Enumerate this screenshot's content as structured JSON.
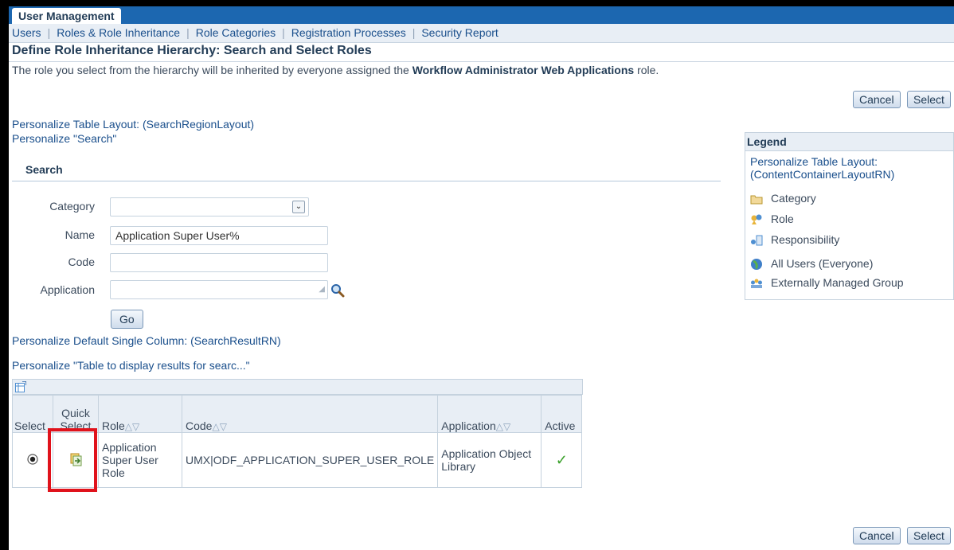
{
  "app_tab": "User Management",
  "nav": [
    "Users",
    "Roles & Role Inheritance",
    "Role Categories",
    "Registration Processes",
    "Security Report"
  ],
  "title": "Define Role Inheritance Hierarchy: Search and Select Roles",
  "instruction": {
    "pre": "The role you select from the hierarchy will be inherited by everyone assigned the ",
    "bold": "Workflow Administrator Web Applications",
    "post": " role."
  },
  "buttons": {
    "cancel": "Cancel",
    "select": "Select",
    "go": "Go"
  },
  "links": {
    "personalize_search_region": "Personalize Table Layout: (SearchRegionLayout)",
    "personalize_search": "Personalize \"Search\"",
    "personalize_default": "Personalize Default Single Column: (SearchResultRN)",
    "personalize_table": "Personalize \"Table to display results for searc...\""
  },
  "search": {
    "heading": "Search",
    "fields": {
      "category": {
        "label": "Category",
        "value": ""
      },
      "name": {
        "label": "Name",
        "value": "Application Super User%"
      },
      "code": {
        "label": "Code",
        "value": ""
      },
      "application": {
        "label": "Application",
        "value": ""
      }
    }
  },
  "legend": {
    "heading": "Legend",
    "link_line1": "Personalize Table Layout:",
    "link_line2": "(ContentContainerLayoutRN)",
    "items": [
      "Category",
      "Role",
      "Responsibility",
      "All Users (Everyone)",
      "Externally Managed Group"
    ]
  },
  "table": {
    "columns": {
      "select": "Select",
      "quick_select_1": "Quick",
      "quick_select_2": "Select",
      "role": "Role",
      "code": "Code",
      "application": "Application",
      "active": "Active"
    },
    "sort_glyph": "△▽",
    "rows": [
      {
        "selected": true,
        "role_1": "Application",
        "role_2": "Super User",
        "role_3": "Role",
        "code": "UMX|ODF_APPLICATION_SUPER_USER_ROLE",
        "application_1": "Application Object",
        "application_2": "Library",
        "active": "✓"
      }
    ]
  },
  "colors": {
    "header_blue": "#1c67b0",
    "link": "#1a4f8c",
    "highlight": "#e0121b",
    "active_check": "#3aa02a"
  }
}
